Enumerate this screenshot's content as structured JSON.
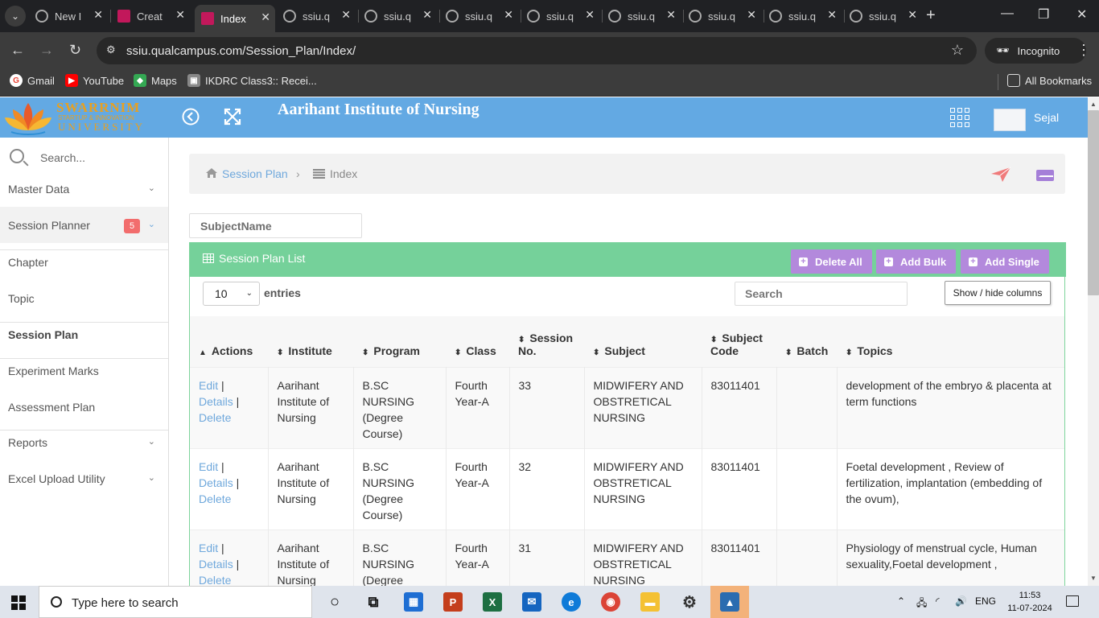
{
  "browser": {
    "tabs": [
      {
        "label": "New I",
        "active": false
      },
      {
        "label": "Creat",
        "active": false
      },
      {
        "label": "Index",
        "active": true
      },
      {
        "label": "ssiu.q",
        "active": false
      },
      {
        "label": "ssiu.q",
        "active": false
      },
      {
        "label": "ssiu.q",
        "active": false
      },
      {
        "label": "ssiu.q",
        "active": false
      },
      {
        "label": "ssiu.q",
        "active": false
      },
      {
        "label": "ssiu.q",
        "active": false
      },
      {
        "label": "ssiu.q",
        "active": false
      },
      {
        "label": "ssiu.q",
        "active": false
      }
    ],
    "url": "ssiu.qualcampus.com/Session_Plan/Index/",
    "incognito_label": "Incognito",
    "bookmarks": [
      "Gmail",
      "YouTube",
      "Maps",
      "IKDRC Class3:: Recei..."
    ],
    "all_bookmarks_label": "All Bookmarks"
  },
  "header": {
    "logo_line1": "SWARRNIM",
    "logo_line2": "STARTUP & INNOVATION",
    "logo_line3": "UNIVERSITY",
    "institute_title": "Aarihant Institute of Nursing",
    "user_name": "Sejal"
  },
  "sidebar": {
    "search_placeholder": "Search...",
    "items": [
      {
        "label": "Master Data",
        "chevron": true
      },
      {
        "label": "Session Planner",
        "chevron": true,
        "badge": "5"
      },
      {
        "label": "Chapter"
      },
      {
        "label": "Topic"
      },
      {
        "label": "Session Plan",
        "active": true
      },
      {
        "label": "Experiment Marks"
      },
      {
        "label": "Assessment Plan"
      },
      {
        "label": "Reports",
        "chevron": true
      },
      {
        "label": "Excel Upload Utility",
        "chevron": true
      }
    ]
  },
  "breadcrumb": {
    "parent": "Session Plan",
    "separator": "›",
    "current": "Index"
  },
  "filter": {
    "subject_placeholder": "SubjectName"
  },
  "panel": {
    "title": "Session Plan List",
    "buttons": {
      "delete_all": "Delete All",
      "add_bulk": "Add Bulk",
      "add_single": "Add Single"
    },
    "entries_value": "10",
    "entries_label": "entries",
    "search_placeholder": "Search",
    "colvis_label": "Show / hide columns"
  },
  "table": {
    "columns": [
      "Actions",
      "Institute",
      "Program",
      "Class",
      "Session No.",
      "Subject",
      "Subject Code",
      "Batch",
      "Topics"
    ],
    "action_labels": {
      "edit": "Edit",
      "details": "Details",
      "delete": "Delete"
    },
    "rows": [
      {
        "institute": "Aarihant Institute of Nursing",
        "program": "B.SC NURSING (Degree Course)",
        "class": "Fourth Year-A",
        "session_no": "33",
        "subject": "MIDWIFERY AND OBSTRETICAL NURSING",
        "subject_code": "83011401",
        "batch": "",
        "topics": "development of the embryo & placenta at term functions"
      },
      {
        "institute": "Aarihant Institute of Nursing",
        "program": "B.SC NURSING (Degree Course)",
        "class": "Fourth Year-A",
        "session_no": "32",
        "subject": "MIDWIFERY AND OBSTRETICAL NURSING",
        "subject_code": "83011401",
        "batch": "",
        "topics": "Foetal development , Review of fertilization, implantation (embedding of the ovum),"
      },
      {
        "institute": "Aarihant Institute of Nursing",
        "program": "B.SC NURSING (Degree Course)",
        "class": "Fourth Year-A",
        "session_no": "31",
        "subject": "MIDWIFERY AND OBSTRETICAL NURSING",
        "subject_code": "83011401",
        "batch": "",
        "topics": "Physiology of menstrual cycle, Human sexuality,Foetal development ,"
      }
    ]
  },
  "taskbar": {
    "search_placeholder": "Type here to search",
    "language": "ENG",
    "time": "11:53",
    "date": "11-07-2024"
  },
  "colors": {
    "header_blue": "#63a9e3",
    "panel_green": "#75d19a",
    "button_purple": "#b389dc",
    "link_blue": "#6fa8dc",
    "badge_red": "#f26d6d"
  }
}
